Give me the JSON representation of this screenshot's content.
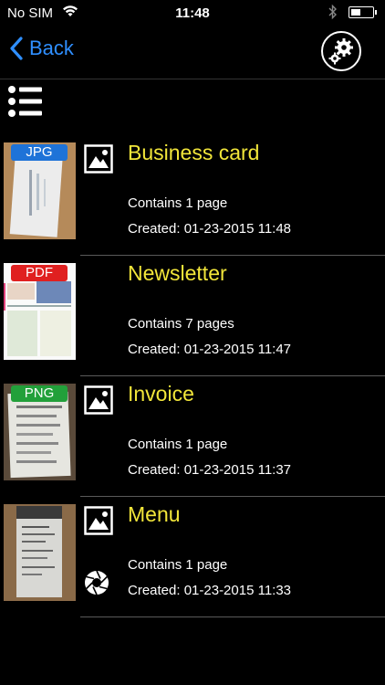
{
  "status_bar": {
    "carrier": "No SIM",
    "time": "11:48"
  },
  "nav": {
    "back_label": "Back"
  },
  "documents": [
    {
      "title": "Business card",
      "badge": "JPG",
      "badge_color": "#1e73d8",
      "pages": "Contains 1 page",
      "created": "Created: 01-23-2015 11:48",
      "source_icon": "image-icon"
    },
    {
      "title": "Newsletter",
      "badge": "PDF",
      "badge_color": "#e02020",
      "pages": "Contains 7 pages",
      "created": "Created: 01-23-2015 11:47",
      "source_icon": ""
    },
    {
      "title": "Invoice",
      "badge": "PNG",
      "badge_color": "#22a03a",
      "pages": "Contains 1 page",
      "created": "Created: 01-23-2015 11:37",
      "source_icon": "image-icon"
    },
    {
      "title": "Menu",
      "badge": "",
      "badge_color": "",
      "pages": "Contains 1 page",
      "created": "Created: 01-23-2015 11:33",
      "source_icon": "image-icon"
    }
  ],
  "colors": {
    "title": "#f2e63a",
    "accent": "#2f8fff",
    "background": "#000000"
  }
}
